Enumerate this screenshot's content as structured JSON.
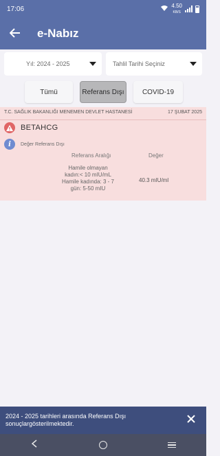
{
  "status_bar": {
    "time": "17:06",
    "speed_value": "4.50",
    "speed_unit": "KB/S"
  },
  "app_bar": {
    "back_icon": "arrow-left-icon",
    "title": "e-Nabız"
  },
  "filters": {
    "year": {
      "label": "Yıl: 2024 - 2025"
    },
    "date": {
      "label": "Tahlil Tarihi Seçiniz"
    }
  },
  "tabs": [
    {
      "label": "Tümü",
      "selected": false
    },
    {
      "label": "Referans Dışı",
      "selected": true
    },
    {
      "label": "COVID-19",
      "selected": false
    }
  ],
  "result": {
    "hospital": "T.C. SAĞLIK BAKANLIĞI MENEMEN DEVLET HASTANESİ",
    "date": "17 ŞUBAT 2025",
    "test_name": "BETAHCG",
    "info_label": "Değer Referans Dışı",
    "col_reference": "Referans Aralığı",
    "col_value": "Değer",
    "reference_range": "Hamile olmayan\nkadın:< 10 mIU/mL\nHamile kadında: 3 - 7\ngün: 5-50 mIU",
    "value": "40.3 mIU/ml",
    "colors": {
      "card_bg": "#f8dede",
      "warning": "#e06565",
      "info": "#6f8bd0"
    }
  },
  "snackbar": {
    "message": "2024 - 2025 tarihleri arasında Referans Dışı sonuçlargösterilmektedir."
  },
  "theme": {
    "primary": "#5a6fa8",
    "snackbar_bg": "#3e4e7d",
    "nav_bg": "#4a4f63",
    "tab_selected_bg": "#b7b7b9"
  }
}
